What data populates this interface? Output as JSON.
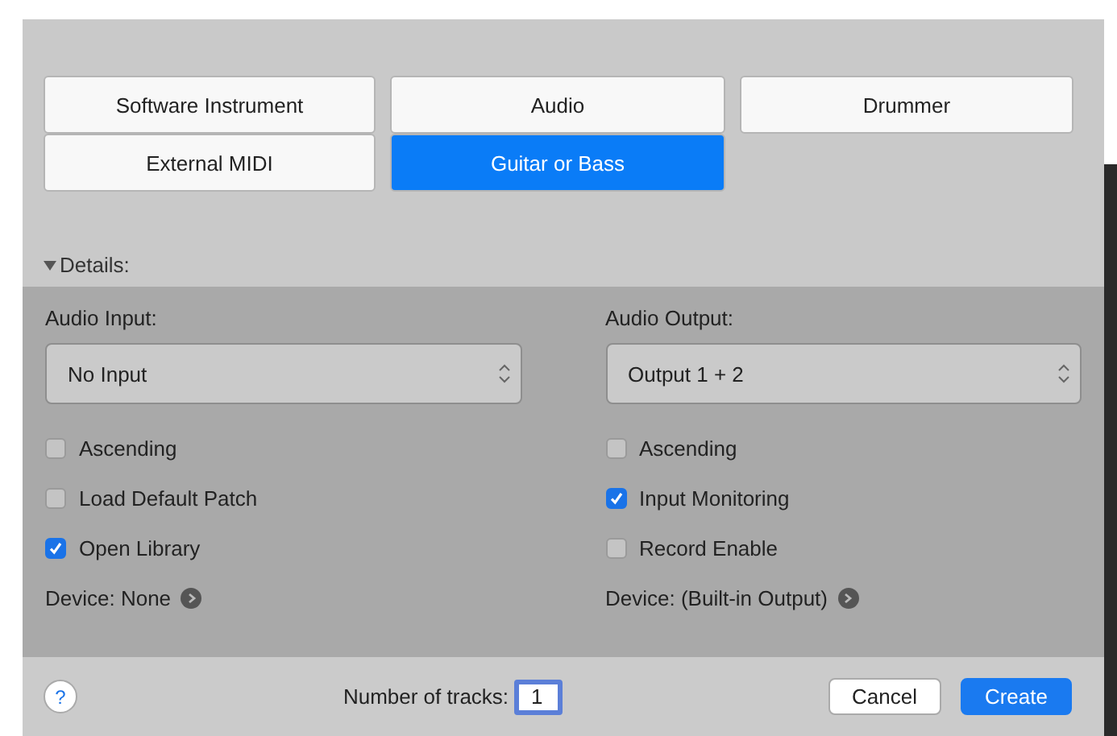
{
  "track_types": [
    {
      "label": "Software Instrument",
      "selected": false
    },
    {
      "label": "Audio",
      "selected": false
    },
    {
      "label": "Drummer",
      "selected": false
    },
    {
      "label": "External MIDI",
      "selected": false
    },
    {
      "label": "Guitar or Bass",
      "selected": true
    }
  ],
  "details": {
    "label": "Details:",
    "expanded": true
  },
  "columns": [
    {
      "heading": "Audio Input:",
      "select": "No Input",
      "options": [
        {
          "label": "Ascending",
          "checked": false
        },
        {
          "label": "Load Default Patch",
          "checked": false
        },
        {
          "label": "Open Library",
          "checked": true
        }
      ],
      "device": "Device: None"
    },
    {
      "heading": "Audio Output:",
      "select": "Output 1 + 2",
      "options": [
        {
          "label": "Ascending",
          "checked": false
        },
        {
          "label": "Input Monitoring",
          "checked": true
        },
        {
          "label": "Record Enable",
          "checked": false
        }
      ],
      "device": "Device: (Built-in Output)"
    }
  ],
  "footer": {
    "help": "?",
    "tracks_label": "Number of tracks:",
    "tracks_value": "1",
    "buttons": [
      {
        "label": "Cancel",
        "kind": "secondary"
      },
      {
        "label": "Create",
        "kind": "primary"
      }
    ]
  }
}
